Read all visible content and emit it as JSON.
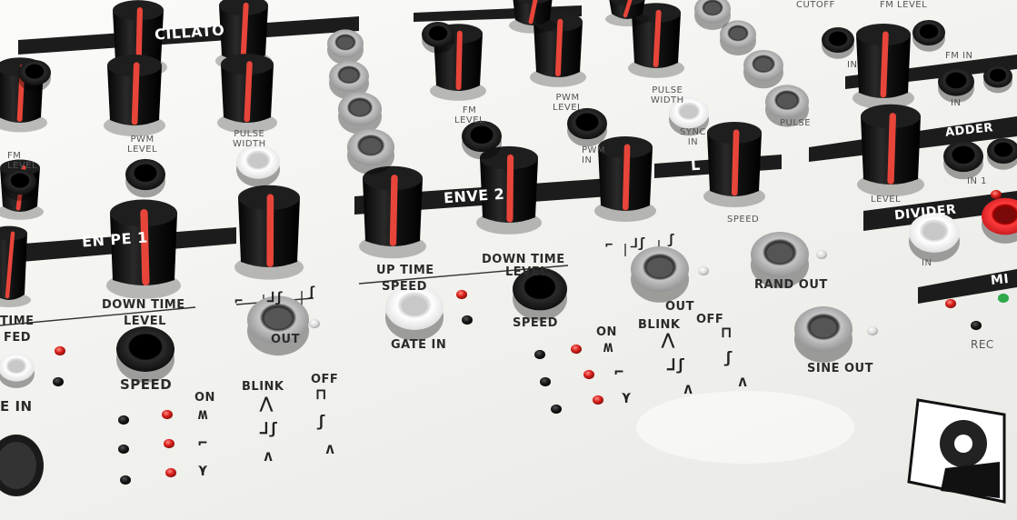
{
  "labels": {
    "oscillator": "CILLATO",
    "fm_level_left": "FM\nLEVEL",
    "pwm_level_left": "PWM\nLEVEL",
    "pulse_width_left": "PULSE\nWIDTH",
    "fm_level_mid": "FM\nLEVEL",
    "pwm_level_mid": "PWM\nLEVEL",
    "pulse_width_mid": "PULSE\nWIDTH",
    "pwm_in": "PWM\nIN",
    "sync_in": "SYNC\nIN",
    "pulse": "PULSE",
    "cutoff": "CUTOFF",
    "fm_level_top": "FM LEVEL",
    "fm_in": "FM IN",
    "in_right": "IN",
    "in_right2": "IN",
    "envelope1": "EN    PE 1",
    "envelope2": "ENVE      2",
    "lfo": "L",
    "adder": "ADDER",
    "in1": "IN 1",
    "level_right": "LEVEL",
    "divider": "DIVIDER",
    "in_divider": "IN",
    "mixer": "MI",
    "rec": "REC",
    "time": "TIME",
    "fed": "FED",
    "down_time_1": "DOWN TIME",
    "level_1": "LEVEL",
    "speed_1": "SPEED",
    "out_1": "OUT",
    "e_in": "E IN",
    "up_time_2": "UP TIME",
    "speed_2a": "SPEED",
    "down_time_2": "DOWN TIME",
    "level_2": "LEVEL",
    "gate_in": "GATE IN",
    "speed_2": "SPEED",
    "out_lfo": "OUT",
    "speed_lfo": "SPEED",
    "rand_out": "RAND OUT",
    "sine_out": "SINE OUT",
    "on_1": "ON",
    "blink_1": "BLINK",
    "off_1": "OFF",
    "on_2": "ON",
    "blink_2": "BLINK",
    "off_2": "OFF"
  },
  "colors": {
    "panel": "#f3f3f0",
    "band": "#1c1c1c",
    "knob_body": "#141414",
    "knob_stripe": "#e8453a",
    "jack_black": "#151515",
    "jack_grey": "#a9a9a9",
    "jack_white": "#f6f6f6",
    "led_red": "#d8201b",
    "led_off": "#222222",
    "led_green": "#2fa84a",
    "jack_red": "#e0222a"
  }
}
